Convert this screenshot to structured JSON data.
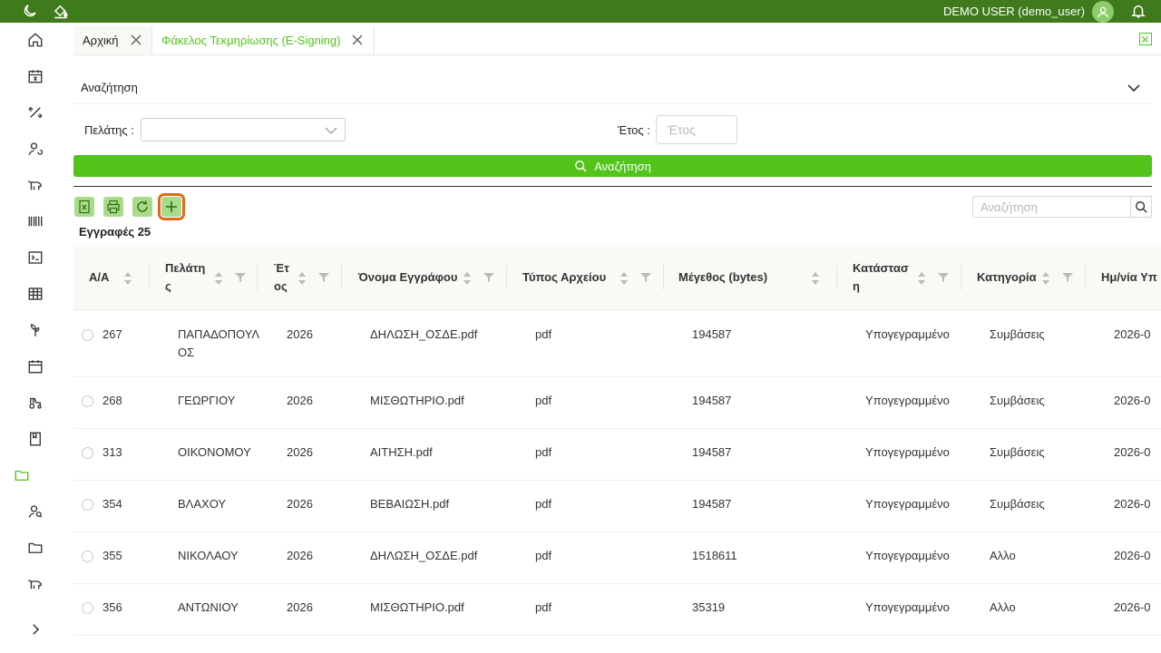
{
  "topbar": {
    "user_name": "DEMO USER (demo_user)",
    "icons": [
      "moon-icon",
      "paint-bucket-icon",
      "user-icon",
      "bell-icon"
    ]
  },
  "sidebar": {
    "items": [
      "home",
      "calendar-yen",
      "satellite",
      "user-refresh",
      "cow",
      "barcode",
      "terminal",
      "table",
      "plant",
      "calendar",
      "tractor",
      "book",
      "folder-active",
      "user-search",
      "folder",
      "cow-2",
      "expand"
    ]
  },
  "tabs": [
    {
      "label": "Αρχική",
      "active": false
    },
    {
      "label": "Φάκελος Τεκμηρίωσης (E-Signing)",
      "active": true
    }
  ],
  "search": {
    "title": "Αναζήτηση",
    "client_label": "Πελάτης :",
    "year_label": "Έτος :",
    "year_placeholder": "Έτος",
    "button_label": "Αναζήτηση"
  },
  "toolbar": {
    "records_label": "Εγγραφές 25",
    "grid_search_placeholder": "Αναζήτηση"
  },
  "colors": {
    "brand": "#3f7a1c",
    "accent": "#52c41a",
    "highlight": "#e06a1a"
  },
  "table": {
    "columns": {
      "aa": "A/A",
      "client_1": "Πελάτη",
      "client_2": "ς",
      "year_1": "Έτ",
      "year_2": "ος",
      "doc_name": "Όνομα Εγγράφου",
      "file_type": "Τύπος Αρχείου",
      "size": "Μέγεθος (bytes)",
      "status_1": "Κατάστασ",
      "status_2": "η",
      "category": "Κατηγορία",
      "date": "Ημ/νία Υπ"
    },
    "rows": [
      {
        "aa": "267",
        "client": "ΠΑΠΑΔΟΠΟΥΛ",
        "client_2": "ΟΣ",
        "year": "2026",
        "doc": "ΔΗΛΩΣΗ_ΟΣΔΕ.pdf",
        "type": "pdf",
        "size": "194587",
        "status": "Υπογεγραμμένο",
        "category": "Συμβάσεις",
        "date": "2026-0"
      },
      {
        "aa": "268",
        "client": "ΓΕΩΡΓΙΟΥ",
        "client_2": "",
        "year": "2026",
        "doc": "ΜΙΣΘΩΤΗΡΙΟ.pdf",
        "type": "pdf",
        "size": "194587",
        "status": "Υπογεγραμμένο",
        "category": "Συμβάσεις",
        "date": "2026-0"
      },
      {
        "aa": "313",
        "client": "ΟΙΚΟΝΟΜΟΥ",
        "client_2": "",
        "year": "2026",
        "doc": "ΑΙΤΗΣΗ.pdf",
        "type": "pdf",
        "size": "194587",
        "status": "Υπογεγραμμένο",
        "category": "Συμβάσεις",
        "date": "2026-0"
      },
      {
        "aa": "354",
        "client": "ΒΛΑΧΟΥ",
        "client_2": "",
        "year": "2026",
        "doc": "ΒΕΒΑΙΩΣΗ.pdf",
        "type": "pdf",
        "size": "194587",
        "status": "Υπογεγραμμένο",
        "category": "Συμβάσεις",
        "date": "2026-0"
      },
      {
        "aa": "355",
        "client": "ΝΙΚΟΛΑΟΥ",
        "client_2": "",
        "year": "2026",
        "doc": "ΔΗΛΩΣΗ_ΟΣΔΕ.pdf",
        "type": "pdf",
        "size": "1518611",
        "status": "Υπογεγραμμένο",
        "category": "Αλλο",
        "date": "2026-0"
      },
      {
        "aa": "356",
        "client": "ΑΝΤΩΝΙΟΥ",
        "client_2": "",
        "year": "2026",
        "doc": "ΜΙΣΘΩΤΗΡΙΟ.pdf",
        "type": "pdf",
        "size": "35319",
        "status": "Υπογεγραμμένο",
        "category": "Αλλο",
        "date": "2026-0"
      }
    ]
  }
}
